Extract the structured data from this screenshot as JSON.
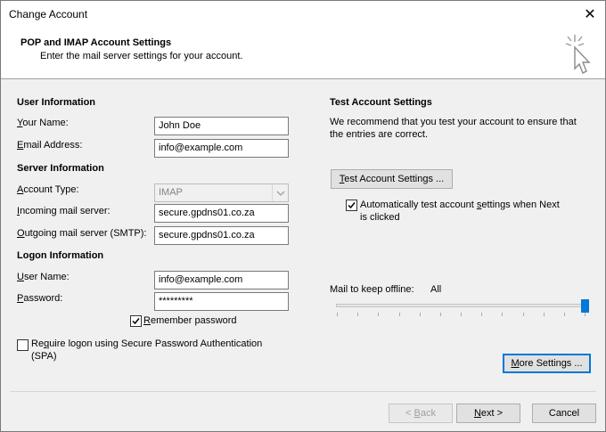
{
  "window": {
    "title": "Change Account",
    "close_glyph": "✕"
  },
  "header": {
    "title": "POP and IMAP Account Settings",
    "subtitle": "Enter the mail server settings for your account.",
    "icon": "cursor-click-icon"
  },
  "user_info": {
    "heading": "User Information",
    "name_label_pre": "",
    "name_label_u": "Y",
    "name_label_post": "our Name:",
    "name_value": "John Doe",
    "email_label_u": "E",
    "email_label_post": "mail Address:",
    "email_value": "info@example.com"
  },
  "server_info": {
    "heading": "Server Information",
    "account_type_label_u": "A",
    "account_type_label_post": "ccount Type:",
    "account_type_value": "IMAP",
    "incoming_label_u": "I",
    "incoming_label_post": "ncoming mail server:",
    "incoming_value": "secure.gpdns01.co.za",
    "outgoing_label_u": "O",
    "outgoing_label_post": "utgoing mail server (SMTP):",
    "outgoing_value": "secure.gpdns01.co.za"
  },
  "logon_info": {
    "heading": "Logon Information",
    "username_label_u": "U",
    "username_label_post": "ser Name:",
    "username_value": "info@example.com",
    "password_label_u": "P",
    "password_label_post": "assword:",
    "password_value": "*********",
    "remember_label_u": "R",
    "remember_label_post": "emember password",
    "remember_checked": true,
    "spa_label_pre": "Re",
    "spa_label_u": "q",
    "spa_label_post": "uire logon using Secure Password Authentication",
    "spa_label_line2": "(SPA)",
    "spa_checked": false
  },
  "test_settings": {
    "heading": "Test Account Settings",
    "description_line1": "We recommend that you test your account to ensure that",
    "description_line2": "the entries are correct.",
    "test_button_u": "T",
    "test_button_post": "est Account Settings ...",
    "auto_test_pre": "Automatically test account ",
    "auto_test_u": "s",
    "auto_test_post": "ettings when Next",
    "auto_test_line2": "is clicked",
    "auto_test_checked": true
  },
  "offline": {
    "label": "Mail to keep offline:",
    "value": "All",
    "slider_position": 1.0
  },
  "buttons": {
    "more_settings_u": "M",
    "more_settings_post": "ore Settings ...",
    "back_pre": "< ",
    "back_u": "B",
    "back_post": "ack",
    "next_u": "N",
    "next_post": "ext >",
    "cancel": "Cancel"
  }
}
